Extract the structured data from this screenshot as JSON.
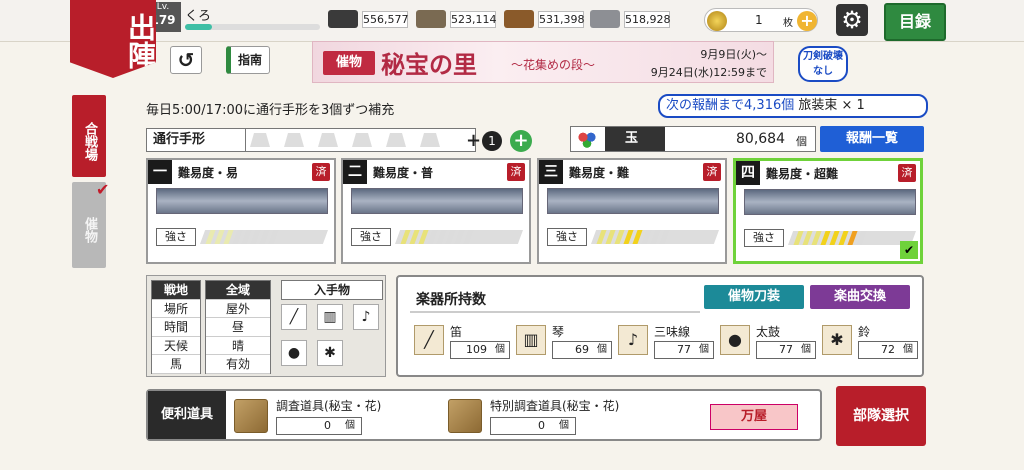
{
  "header": {
    "sortie_label": "出陣",
    "level_label": "Lv.",
    "level": "179",
    "player_name": "くろ",
    "resources": [
      {
        "name": "charcoal",
        "value": "556,577",
        "color": "#3a3a3a"
      },
      {
        "name": "cooling-water",
        "value": "523,114",
        "color": "#7a6a52"
      },
      {
        "name": "whetstone",
        "value": "531,398",
        "color": "#8a5a2a"
      },
      {
        "name": "steel",
        "value": "518,928",
        "color": "#8d8f94"
      }
    ],
    "koban_value": "1",
    "koban_unit": "枚",
    "catalog_label": "目録"
  },
  "nav": {
    "back_symbol": "↺",
    "guide_label": "指南",
    "breakage_label": "刀剣破壊なし"
  },
  "banner": {
    "tag": "催物",
    "title": "秘宝の里",
    "subtitle": "〜花集めの段〜",
    "date_start": "9月9日(火)〜",
    "date_end": "9月24日(水)12:59まで"
  },
  "left_tabs": {
    "tab1": "合戦場",
    "tab2": "催物"
  },
  "info": {
    "replenish_text": "毎日5:00/17:00に通行手形を3個ずつ補充",
    "reward_next_prefix": "次の報酬まで",
    "reward_next_count": "4,316個",
    "reward_next_item": "旅装束",
    "reward_next_mult": "× 1"
  },
  "pass": {
    "label": "通行手形",
    "plus": "+",
    "count": "1",
    "add_symbol": "+"
  },
  "gyoku": {
    "label": "玉",
    "value": "80,684",
    "unit": "個",
    "reward_list_label": "報酬一覧"
  },
  "difficulties": [
    {
      "num": "一",
      "name": "難易度・易",
      "done": "済",
      "strength_label": "強さ",
      "level": 0.0
    },
    {
      "num": "二",
      "name": "難易度・普",
      "done": "済",
      "strength_label": "強さ",
      "level": 0.375
    },
    {
      "num": "三",
      "name": "難易度・難",
      "done": "済",
      "strength_label": "強さ",
      "level": 0.625
    },
    {
      "num": "四",
      "name": "難易度・超難",
      "done": "済",
      "strength_label": "強さ",
      "level": 0.875,
      "selected": true
    }
  ],
  "conditions": {
    "labels": [
      "戦地",
      "場所",
      "時間",
      "天候",
      "馬"
    ],
    "values": [
      "全域",
      "屋外",
      "昼",
      "晴",
      "有効"
    ],
    "drops_title": "入手物"
  },
  "instruments": {
    "title": "楽器所持数",
    "saibutsu_label": "催物刀装",
    "gakkyoku_label": "楽曲交換",
    "items": [
      {
        "name": "笛",
        "count": "109",
        "unit": "個"
      },
      {
        "name": "琴",
        "count": "69",
        "unit": "個"
      },
      {
        "name": "三味線",
        "count": "77",
        "unit": "個"
      },
      {
        "name": "太鼓",
        "count": "77",
        "unit": "個"
      },
      {
        "name": "鈴",
        "count": "72",
        "unit": "個"
      }
    ]
  },
  "tools": {
    "label": "便利道具",
    "items": [
      {
        "name": "調査道具(秘宝・花)",
        "count": "0",
        "unit": "個"
      },
      {
        "name": "特別調査道具(秘宝・花)",
        "count": "0",
        "unit": "個"
      }
    ],
    "shop_label": "万屋",
    "squad_label": "部隊選択"
  }
}
